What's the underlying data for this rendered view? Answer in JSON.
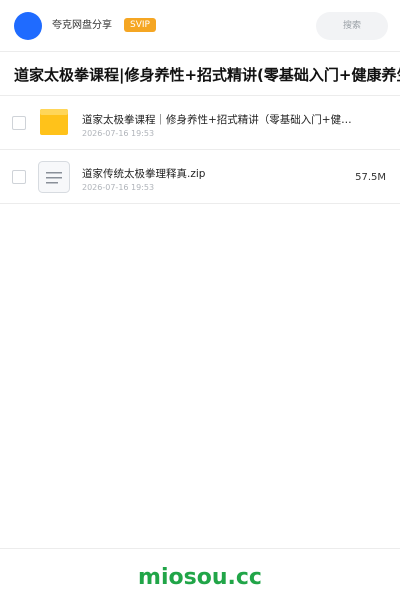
{
  "header": {
    "user_name": "夸克网盘分享",
    "vip_badge": "SVIP",
    "search_placeholder": "搜索"
  },
  "title": "道家太极拳课程|修身养性+招式精讲(零基础入门+健康养生)",
  "files": [
    {
      "name": "道家太极拳课程｜修身养性+招式精讲（零基础入门+健康养生）",
      "date": "2026-07-16 19:53",
      "size": "",
      "icon": "folder-icon"
    },
    {
      "name": "道家传统太极拳理释真.zip",
      "date": "2026-07-16 19:53",
      "size": "57.5M",
      "icon": "zip-file-icon"
    }
  ],
  "footer": {
    "brand": "miosou.cc"
  },
  "colors": {
    "avatar": "#1f6bff",
    "vip": "#f5a623",
    "folder": "#ffc21a",
    "brand": "#21a548"
  }
}
